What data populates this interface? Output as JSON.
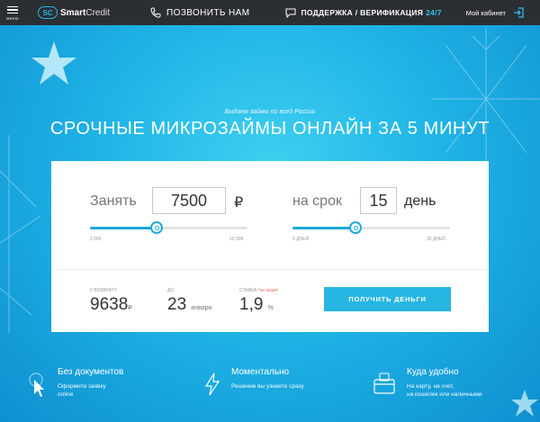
{
  "topbar": {
    "menu_label": "МЕНЮ",
    "logo_badge": "SC",
    "logo_word_1": "Smart",
    "logo_word_2": "Credit",
    "call_label": "ПОЗВОНИТЬ НАМ",
    "support_label": "ПОДДЕРЖКА / ВЕРИФИКАЦИЯ",
    "support_hours": "24/7",
    "cabinet_label": "Мой кабинет"
  },
  "hero": {
    "subtitle": "Выдаем займы по всей России",
    "title": "СРОЧНЫЕ МИКРОЗАЙМЫ ОНЛАЙН ЗА 5 МИНУТ"
  },
  "calculator": {
    "amount": {
      "label": "Занять",
      "value": "7500",
      "unit": "₽",
      "min_label": "2 000",
      "max_label": "15 000",
      "min": 2000,
      "max": 15000,
      "current": 7500
    },
    "term": {
      "label": "на срок",
      "value": "15",
      "unit": "день",
      "min_label": "5 ДНЕЙ",
      "max_label": "30 ДНЕЙ",
      "min": 5,
      "max": 30,
      "current": 15
    },
    "summary": {
      "return_caption": "К ВОЗВРАТУ",
      "return_value": "9638",
      "return_unit": "₽",
      "until_caption": "ДО",
      "until_day": "23",
      "until_month": "января",
      "rate_caption": "СТАВКА",
      "rate_note": "*не акция",
      "rate_value": "1,9",
      "rate_unit": "%"
    },
    "cta_label": "ПОЛУЧИТЬ ДЕНЬГИ"
  },
  "features": [
    {
      "title": "Без документов",
      "line1": "Оформите заявку",
      "line2": "online"
    },
    {
      "title": "Моментально",
      "line1": "Решение вы узнаете сразу",
      "line2": ""
    },
    {
      "title": "Куда удобно",
      "line1": "На карту, на счет,",
      "line2": "на кошелек или наличными"
    }
  ],
  "colors": {
    "topbar": "#2b2f33",
    "accent": "#1ea9dc",
    "button": "#27b5e1",
    "note": "#f06a5a"
  }
}
